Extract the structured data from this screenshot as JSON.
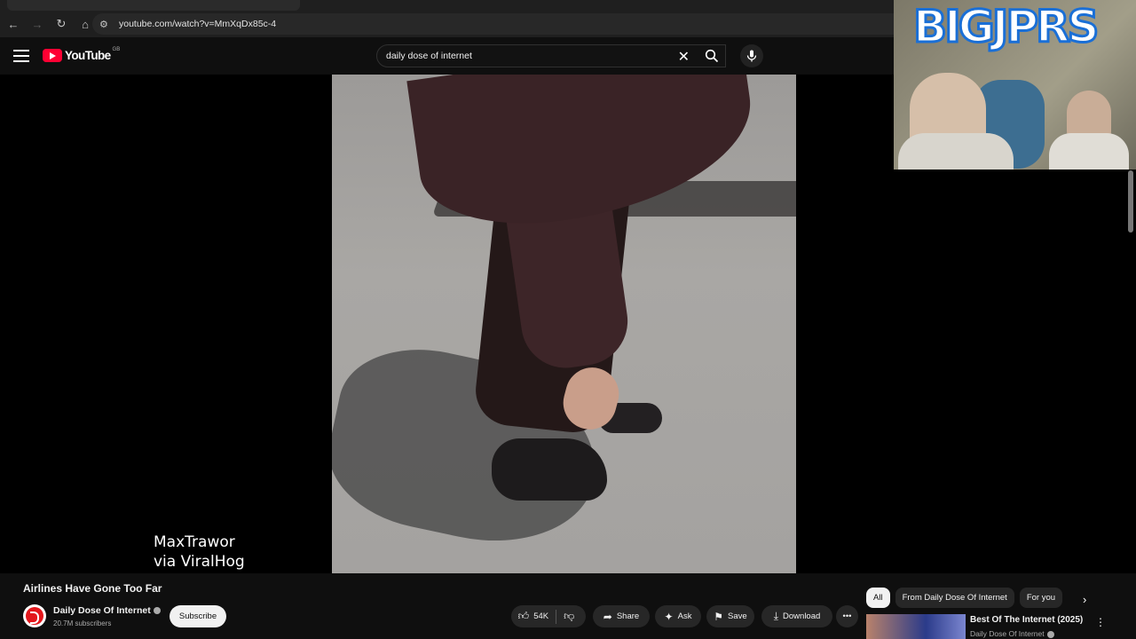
{
  "browser": {
    "url": "youtube.com/watch?v=MmXqDx85c-4"
  },
  "header": {
    "logo_text": "YouTube",
    "country_code": "GB",
    "search_query": "daily dose of internet"
  },
  "video": {
    "watermark_line1": "MaxTrawor",
    "watermark_line2": "via ViralHog",
    "title": "Airlines Have Gone Too Far"
  },
  "webcam_overlay": {
    "banner_text": "BIGJPRS"
  },
  "channel": {
    "name": "Daily Dose Of Internet",
    "subscribers": "20.7M subscribers",
    "subscribe_label": "Subscribe"
  },
  "actions": {
    "like_count": "54K",
    "share_label": "Share",
    "ask_label": "Ask",
    "save_label": "Save",
    "download_label": "Download",
    "more_label": "•••"
  },
  "chips": [
    {
      "label": "All",
      "active": true
    },
    {
      "label": "From Daily Dose Of Internet",
      "active": false
    },
    {
      "label": "For you",
      "active": false
    }
  ],
  "recommendation": {
    "title": "Best Of The Internet (2025)",
    "channel": "Daily Dose Of Internet"
  },
  "colors": {
    "background": "#0f0f0f",
    "brand_red": "#ff0033",
    "pill_bg": "#272727"
  }
}
